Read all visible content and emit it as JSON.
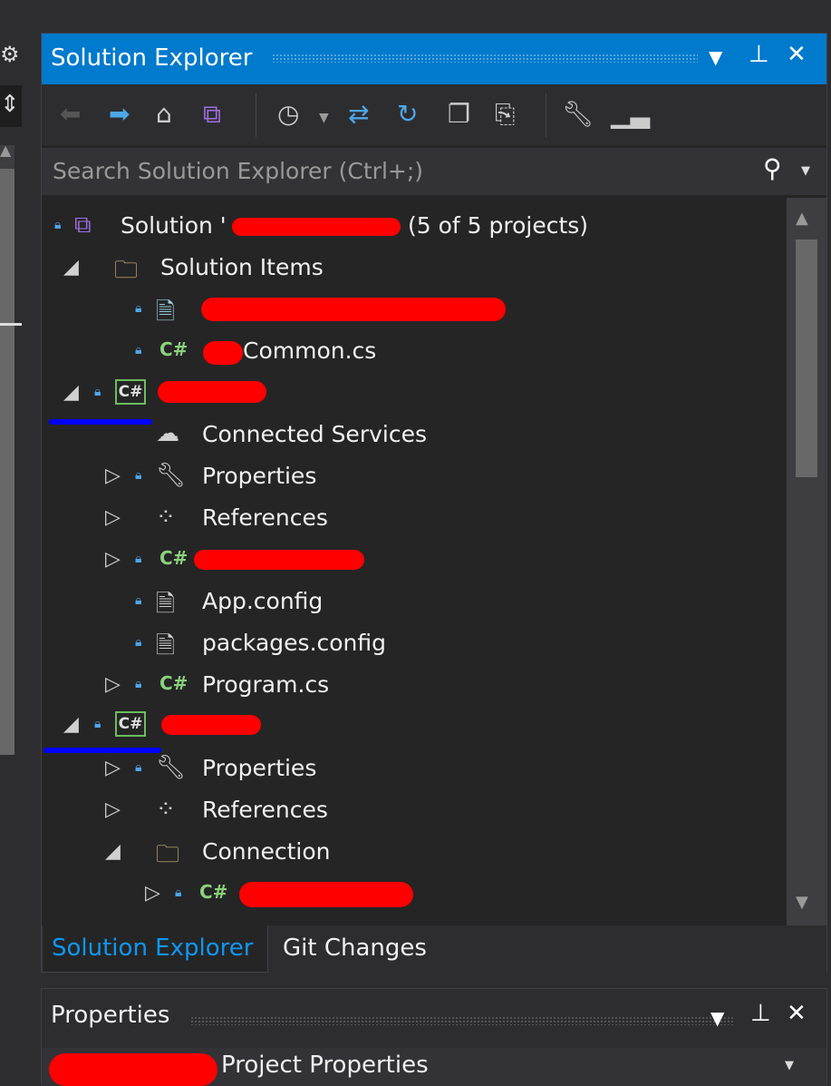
{
  "panel": {
    "title": "Solution Explorer",
    "buttons": {
      "dropdown": "▼",
      "pin": "📌",
      "close": "✕"
    },
    "accent_color": "#007acc"
  },
  "toolbar": {
    "icons": [
      "back-icon",
      "forward-icon",
      "home-icon",
      "switch-views-icon",
      "pending-changes-filter-icon",
      "sync-icon",
      "refresh-icon",
      "collapse-all-icon",
      "show-all-files-icon",
      "properties-icon",
      "preview-icon"
    ]
  },
  "search": {
    "placeholder": "Search Solution Explorer (Ctrl+;)"
  },
  "tree": {
    "solution": {
      "prefix": "Solution '",
      "suffix": "(5 of 5 projects)"
    },
    "solution_items": "Solution Items",
    "common_file": "Common.cs",
    "connected_services": "Connected Services",
    "properties": "Properties",
    "references": "References",
    "app_config": "App.config",
    "packages_config": "packages.config",
    "program_cs": "Program.cs",
    "connection": "Connection",
    "csharp_label": "C#"
  },
  "tabs": [
    {
      "label": "Solution Explorer",
      "active": true
    },
    {
      "label": "Git Changes",
      "active": false
    }
  ],
  "properties_panel": {
    "title": "Properties",
    "selected": "Project Properties"
  }
}
